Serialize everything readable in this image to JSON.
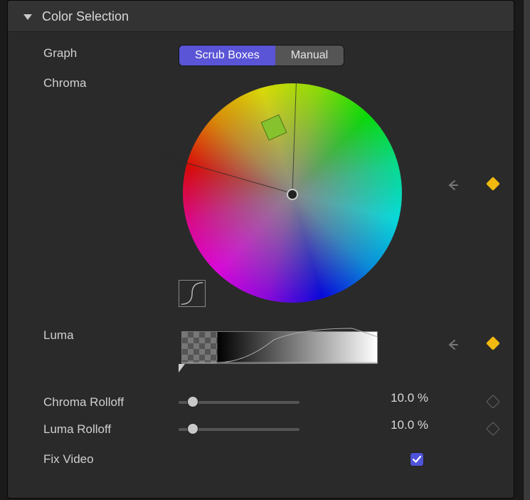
{
  "section": {
    "title": "Color Selection"
  },
  "graph": {
    "label": "Graph",
    "options": [
      "Scrub Boxes",
      "Manual"
    ],
    "selected": "Scrub Boxes"
  },
  "chroma": {
    "label": "Chroma",
    "keyframe_active": true,
    "swatch_color": "#86c22e"
  },
  "luma": {
    "label": "Luma",
    "keyframe_active": true
  },
  "chroma_rolloff": {
    "label": "Chroma Rolloff",
    "value": 10.0,
    "unit": "%",
    "display": "10.0 %",
    "keyframe_active": false
  },
  "luma_rolloff": {
    "label": "Luma Rolloff",
    "value": 10.0,
    "unit": "%",
    "display": "10.0 %",
    "keyframe_active": false
  },
  "fix_video": {
    "label": "Fix Video",
    "checked": true
  },
  "colors": {
    "accent": "#5a54d6",
    "keyframe": "#f2b90e"
  }
}
